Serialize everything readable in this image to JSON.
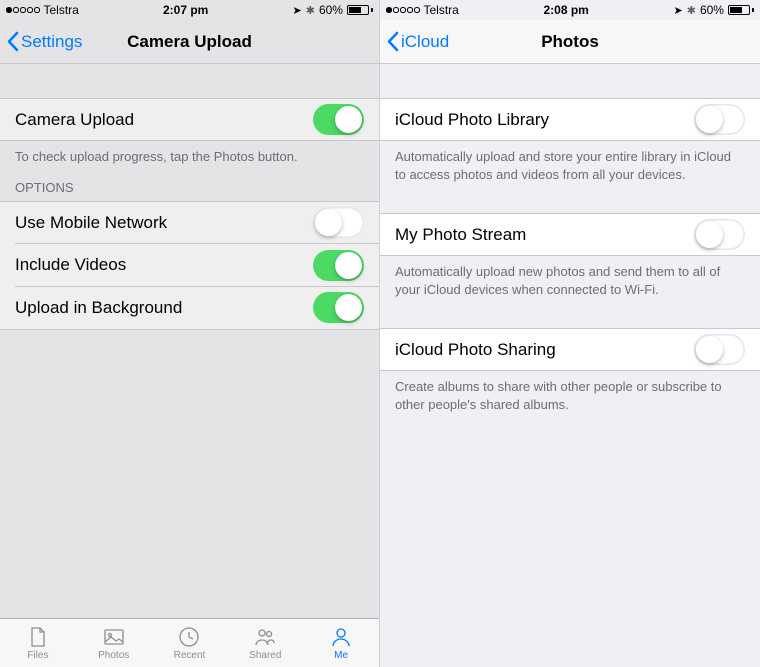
{
  "left": {
    "status": {
      "carrier": "Telstra",
      "time": "2:07 pm",
      "battery_pct": "60%"
    },
    "nav": {
      "back": "Settings",
      "title": "Camera Upload"
    },
    "camera_upload": {
      "label": "Camera Upload",
      "on": true
    },
    "camera_upload_footer": "To check upload progress, tap the Photos button.",
    "options_header": "OPTIONS",
    "options": [
      {
        "label": "Use Mobile Network",
        "on": false
      },
      {
        "label": "Include Videos",
        "on": true
      },
      {
        "label": "Upload in Background",
        "on": true
      }
    ],
    "tabs": [
      {
        "label": "Files"
      },
      {
        "label": "Photos"
      },
      {
        "label": "Recent"
      },
      {
        "label": "Shared"
      },
      {
        "label": "Me"
      }
    ]
  },
  "right": {
    "status": {
      "carrier": "Telstra",
      "time": "2:08 pm",
      "battery_pct": "60%"
    },
    "nav": {
      "back": "iCloud",
      "title": "Photos"
    },
    "rows": [
      {
        "label": "iCloud Photo Library",
        "on": false,
        "footer": "Automatically upload and store your entire library in iCloud to access photos and videos from all your devices."
      },
      {
        "label": "My Photo Stream",
        "on": false,
        "footer": "Automatically upload new photos and send them to all of your iCloud devices when connected to Wi-Fi."
      },
      {
        "label": "iCloud Photo Sharing",
        "on": false,
        "footer": "Create albums to share with other people or subscribe to other people's shared albums."
      }
    ]
  }
}
